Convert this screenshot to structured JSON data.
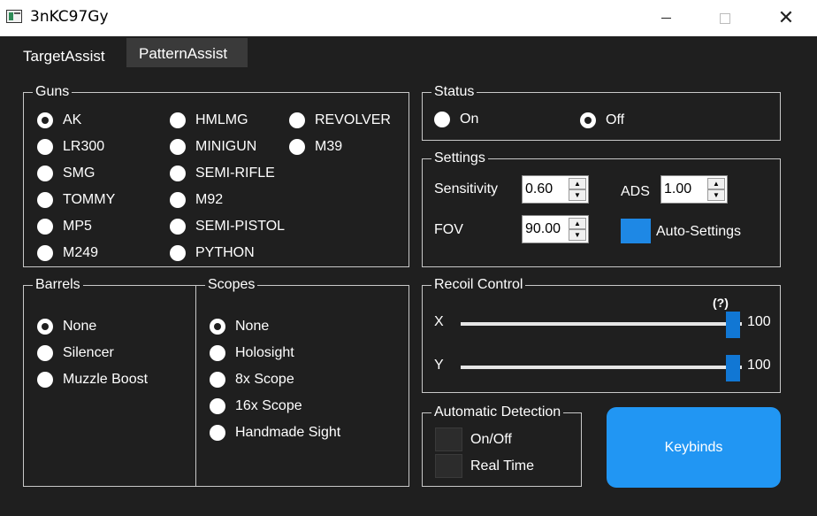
{
  "window": {
    "title": "3nKC97Gy",
    "minimize": "",
    "maximize": "",
    "close": "✕"
  },
  "tabs": [
    {
      "label": "TargetAssist",
      "selected": true
    },
    {
      "label": "PatternAssist",
      "selected": false
    }
  ],
  "guns": {
    "label": "Guns",
    "selected": "AK",
    "col1": [
      "AK",
      "LR300",
      "SMG",
      "TOMMY",
      "MP5",
      "M249"
    ],
    "col2": [
      "HMLMG",
      "MINIGUN",
      "SEMI-RIFLE",
      "M92",
      "SEMI-PISTOL",
      "PYTHON"
    ],
    "col3": [
      "REVOLVER",
      "M39"
    ]
  },
  "barrels": {
    "label": "Barrels",
    "selected": "None",
    "items": [
      "None",
      "Silencer",
      "Muzzle Boost"
    ]
  },
  "scopes": {
    "label": "Scopes",
    "selected": "None",
    "items": [
      "None",
      "Holosight",
      "8x Scope",
      "16x Scope",
      "Handmade Sight"
    ]
  },
  "status": {
    "label": "Status",
    "on": "On",
    "off": "Off",
    "selected": "Off"
  },
  "settings": {
    "label": "Settings",
    "sensitivity_label": "Sensitivity",
    "sensitivity": "0.60",
    "ads_label": "ADS",
    "ads": "1.00",
    "fov_label": "FOV",
    "fov": "90.00",
    "auto_label": "Auto-Settings",
    "accent": "#1e88e5"
  },
  "recoil": {
    "label": "Recoil Control",
    "help": "(?)",
    "x_label": "X",
    "x_value": "100",
    "x_fraction": 1.0,
    "y_label": "Y",
    "y_value": "100",
    "y_fraction": 1.0
  },
  "detection": {
    "label": "Automatic Detection",
    "onoff": "On/Off",
    "realtime": "Real Time"
  },
  "keybinds": {
    "label": "Keybinds",
    "color": "#2196f3"
  }
}
